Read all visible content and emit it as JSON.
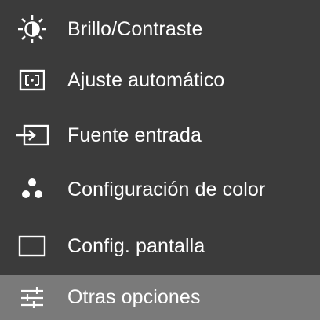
{
  "menu": {
    "items": [
      {
        "label": "Brillo/Contraste",
        "icon": "brightness-contrast-icon",
        "selected": false
      },
      {
        "label": "Ajuste automático",
        "icon": "auto-adjust-icon",
        "selected": false
      },
      {
        "label": "Fuente entrada",
        "icon": "input-source-icon",
        "selected": false
      },
      {
        "label": "Configuración de color",
        "icon": "color-dots-icon",
        "selected": false
      },
      {
        "label": "Config. pantalla",
        "icon": "display-rectangle-icon",
        "selected": false
      },
      {
        "label": "Otras opciones",
        "icon": "sliders-icon",
        "selected": true
      }
    ]
  },
  "colors": {
    "background": "#3b3b3b",
    "selected_background": "#7a7a7a",
    "text": "#ffffff"
  }
}
